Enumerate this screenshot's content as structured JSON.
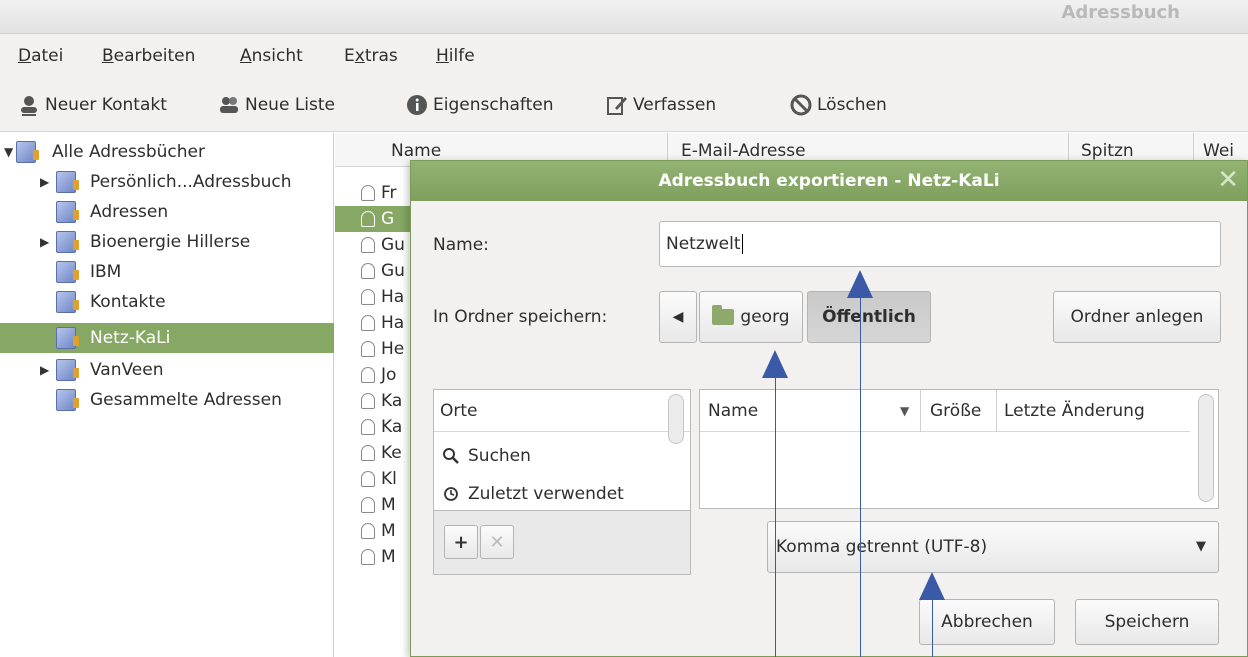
{
  "window": {
    "title": "Adressbuch"
  },
  "menu": [
    "Datei",
    "Bearbeiten",
    "Ansicht",
    "Extras",
    "Hilfe"
  ],
  "menu_mnemonic_index": [
    0,
    0,
    0,
    1,
    0
  ],
  "toolbar": {
    "new_contact": "Neuer Kontakt",
    "new_list": "Neue Liste",
    "properties": "Eigenschaften",
    "compose": "Verfassen",
    "delete": "Löschen"
  },
  "sidebar": {
    "items": [
      {
        "label": "Alle Adressbücher"
      },
      {
        "label": "Persönlich...Adressbuch"
      },
      {
        "label": "Adressen"
      },
      {
        "label": "Bioenergie Hillerse"
      },
      {
        "label": "IBM"
      },
      {
        "label": "Kontakte"
      },
      {
        "label": "Netz-KaLi"
      },
      {
        "label": "VanVeen"
      },
      {
        "label": "Gesammelte Adressen"
      }
    ]
  },
  "contact_list": {
    "columns": [
      "Name",
      "E-Mail-Adresse",
      "Spitzn",
      "Wei"
    ],
    "rows": [
      "Fr",
      "G",
      "Gu",
      "Gu",
      "Ha",
      "Ha",
      "He",
      "Jo",
      "Ka",
      "Ka",
      "Ke",
      "Kl",
      "M",
      "M",
      "M"
    ]
  },
  "dialog": {
    "title": "Adressbuch exportieren - Netz-KaLi",
    "name_label": "Name:",
    "name_value": "Netzwelt",
    "folder_label": "In Ordner speichern:",
    "path_buttons": [
      "georg",
      "Öffentlich"
    ],
    "create_folder": "Ordner anlegen",
    "places_header": "Orte",
    "places": [
      "Suchen",
      "Zuletzt verwendet"
    ],
    "files_columns": [
      "Name",
      "Größe",
      "Letzte Änderung"
    ],
    "format": "Komma getrennt (UTF-8)",
    "cancel": "Abbrechen",
    "save": "Speichern"
  },
  "colors": {
    "accent": "#86a864",
    "title_bar": "#7f9f5f",
    "annotation": "#3a5aa8"
  }
}
